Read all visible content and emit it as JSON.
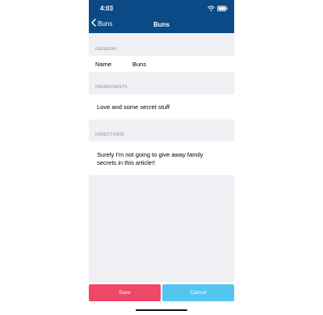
{
  "status_bar": {
    "time": "4:03"
  },
  "nav": {
    "back_label": "Buns",
    "title": "Buns"
  },
  "general": {
    "header": "GENERAL",
    "name_label": "Name",
    "name_value": "Buns"
  },
  "ingredients": {
    "header": "INGREDIENTS",
    "text": "Love and some secret stuff"
  },
  "directions": {
    "header": "DIRECTIONS",
    "text": "Surely I'm not going to give away family\nsecrets in this article!!"
  },
  "buttons": {
    "save": "Save",
    "cancel": "Cancel"
  },
  "colors": {
    "header": "#0b4a86",
    "save": "#ef4767",
    "cancel": "#52c6ef",
    "background": "#efeff4"
  },
  "icons": [
    "wifi-icon",
    "battery-icon",
    "chevron-left-icon"
  ]
}
